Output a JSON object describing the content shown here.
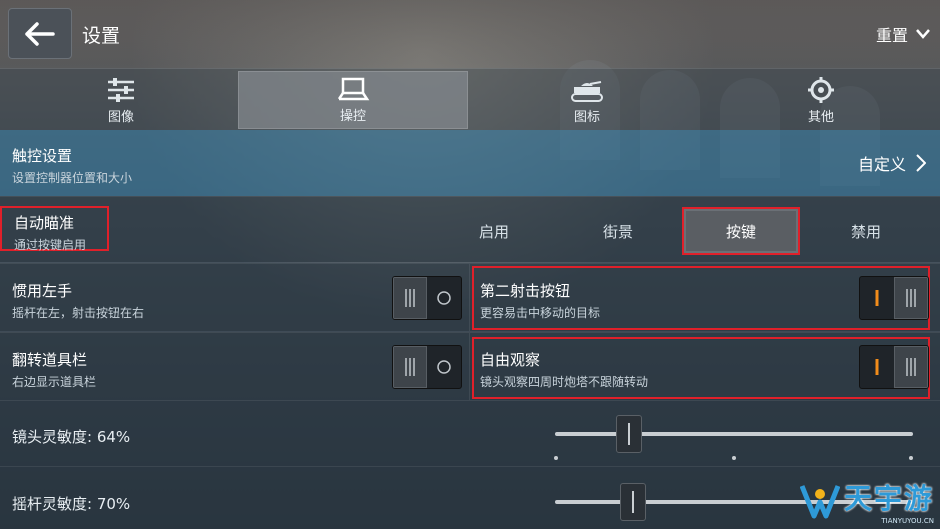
{
  "header": {
    "title": "设置",
    "reset_label": "重置"
  },
  "tabs": [
    {
      "label": "图像",
      "icon": "sliders-icon",
      "active": false
    },
    {
      "label": "操控",
      "icon": "control-icon",
      "active": true
    },
    {
      "label": "图标",
      "icon": "tank-icon",
      "active": false
    },
    {
      "label": "其他",
      "icon": "gear-icon",
      "active": false
    }
  ],
  "touch_settings": {
    "title": "触控设置",
    "subtitle": "设置控制器位置和大小",
    "value": "自定义"
  },
  "auto_aim": {
    "title": "自动瞄准",
    "subtitle": "通过按键启用",
    "options": [
      "启用",
      "街景",
      "按键",
      "禁用"
    ],
    "selected": "按键"
  },
  "left_hand": {
    "title": "惯用左手",
    "subtitle": "摇杆在左，射击按钮在右",
    "on": false
  },
  "second_fire": {
    "title": "第二射击按钮",
    "subtitle": "更容易击中移动的目标",
    "on": true
  },
  "flip_toolbar": {
    "title": "翻转道具栏",
    "subtitle": "右边显示道具栏",
    "on": false
  },
  "free_look": {
    "title": "自由观察",
    "subtitle": "镜头观察四周时炮塔不跟随转动",
    "on": true
  },
  "camera_sensitivity": {
    "label": "镜头灵敏度: 64%",
    "value": 64
  },
  "stick_sensitivity": {
    "label": "摇杆灵敏度: 70%",
    "value": 70
  },
  "watermark": {
    "text": "天宇游",
    "sub": "TIANYUYOU.CN"
  },
  "colors": {
    "highlight_red": "#e0202a",
    "toggle_on": "#f28c1a",
    "touch_row_blue": "#346c8c"
  }
}
